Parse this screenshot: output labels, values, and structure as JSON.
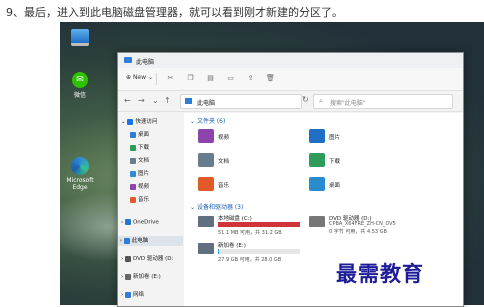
{
  "caption": "9、最后，进入到此电脑磁盘管理器，就可以看到刚才新建的分区了。",
  "desktop": {
    "icons": [
      {
        "label": "",
        "kind": "pc"
      },
      {
        "label": "微信",
        "kind": "wechat"
      },
      {
        "label": "Microsoft Edge",
        "kind": "edge"
      }
    ]
  },
  "window": {
    "title": "此电脑",
    "toolbar": {
      "new_label": "New",
      "icons": [
        "scissors-icon",
        "copy-icon",
        "paste-icon",
        "rename-icon",
        "share-icon",
        "delete-icon"
      ]
    },
    "address": {
      "path": "此电脑",
      "search_placeholder": "搜索\"此电脑\""
    },
    "sidebar": [
      {
        "label": "快速访问",
        "color": "#1a73e8"
      },
      {
        "label": "桌面",
        "color": "#2f7dd8"
      },
      {
        "label": "下载",
        "color": "#2f9d5a"
      },
      {
        "label": "文档",
        "color": "#6a7b8c"
      },
      {
        "label": "图片",
        "color": "#2f8bd8"
      },
      {
        "label": "视频",
        "color": "#8e44ad"
      },
      {
        "label": "音乐",
        "color": "#e05a2a"
      },
      {
        "label": "OneDrive",
        "color": "#1f78d1"
      },
      {
        "label": "此电脑",
        "color": "#2f7dd8"
      },
      {
        "label": "DVD 驱动器 (D:",
        "color": "#555"
      },
      {
        "label": "新加卷 (E:)",
        "color": "#666"
      },
      {
        "label": "网络",
        "color": "#2f7dd8"
      }
    ],
    "folders_header": "文件夹 (6)",
    "folders": [
      {
        "label": "视频",
        "color": "#8e44ad"
      },
      {
        "label": "图片",
        "color": "#1f6fc4"
      },
      {
        "label": "文档",
        "color": "#6a7b8c"
      },
      {
        "label": "下载",
        "color": "#2f9d5a"
      },
      {
        "label": "音乐",
        "color": "#e05a2a"
      },
      {
        "label": "桌面",
        "color": "#2a8ccf"
      }
    ],
    "drives_header": "设备和驱动器 (3)",
    "drives": [
      {
        "name": "本地磁盘 (C:)",
        "space": "51.1 MB 可用，共 31.2 GB",
        "used": 0.998,
        "color": "#d13438"
      },
      {
        "name": "DVD 驱动器 (D:)",
        "space": "CPBA_X64FRE_ZH-CN_DV5",
        "space2": "0 字节 可用，共 4.53 GB"
      },
      {
        "name": "新加卷 (E:)",
        "space": "27.9 GB 可用，共 28.0 GB",
        "used": 0.004,
        "color": "#26a0da"
      }
    ]
  },
  "watermark": "最需教育"
}
